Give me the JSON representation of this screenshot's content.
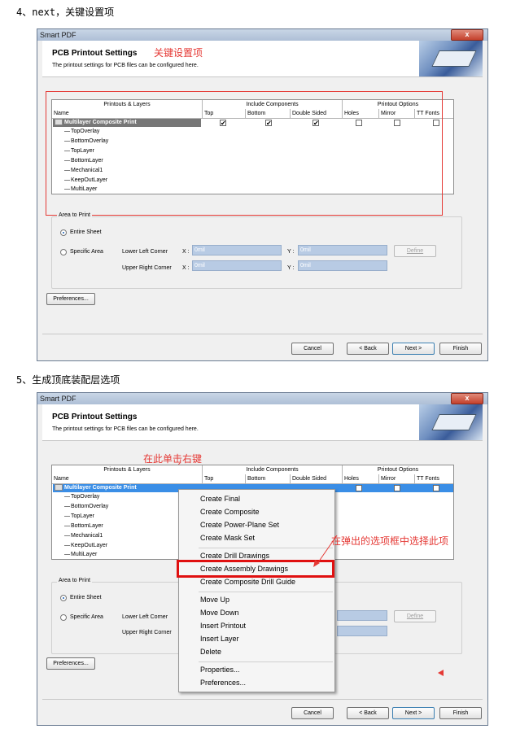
{
  "step4": {
    "caption": "4、next，关键设置项",
    "annotation": "关键设置项"
  },
  "step5": {
    "caption": "5、生成顶底装配层选项",
    "annotation_rightclick": "在此单击右键",
    "annotation_select": "在弹出的选项框中选择此项"
  },
  "dialog": {
    "title": "Smart PDF",
    "close_label": "x",
    "heading": "PCB Printout Settings",
    "subheading": "The printout settings for PCB files can be configured here.",
    "table": {
      "group_headers": [
        "Printouts & Layers",
        "Include Components",
        "Printout Options"
      ],
      "columns": [
        "Name",
        "Top",
        "Bottom",
        "Double Sided",
        "Holes",
        "Mirror",
        "TT Fonts"
      ],
      "root": "Multilayer Composite Print",
      "layers": [
        "TopOverlay",
        "BottomOverlay",
        "TopLayer",
        "BottomLayer",
        "Mechanical1",
        "KeepOutLayer",
        "MultiLayer"
      ],
      "checks": {
        "Top": true,
        "Bottom": true,
        "Double Sided": true,
        "Holes": false,
        "Mirror": false,
        "TT Fonts": false
      }
    },
    "area": {
      "label": "Area to Print",
      "entire": "Entire Sheet",
      "specific": "Specific Area",
      "lower_left": "Lower Left Corner",
      "upper_right": "Upper Right Corner",
      "x_label": "X :",
      "y_label": "Y :",
      "value": "0mil",
      "define": "Define"
    },
    "preferences": "Preferences...",
    "buttons": {
      "cancel": "Cancel",
      "back": "< Back",
      "next": "Next >",
      "finish": "Finish"
    }
  },
  "context_menu": {
    "items": [
      "Create Final",
      "Create Composite",
      "Create Power-Plane Set",
      "Create Mask Set",
      "Create Drill Drawings",
      "Create Assembly Drawings",
      "Create Composite Drill Guide",
      "Move Up",
      "Move Down",
      "Insert Printout",
      "Insert Layer",
      "Delete",
      "Properties...",
      "Preferences..."
    ],
    "highlighted": "Create Assembly Drawings"
  }
}
